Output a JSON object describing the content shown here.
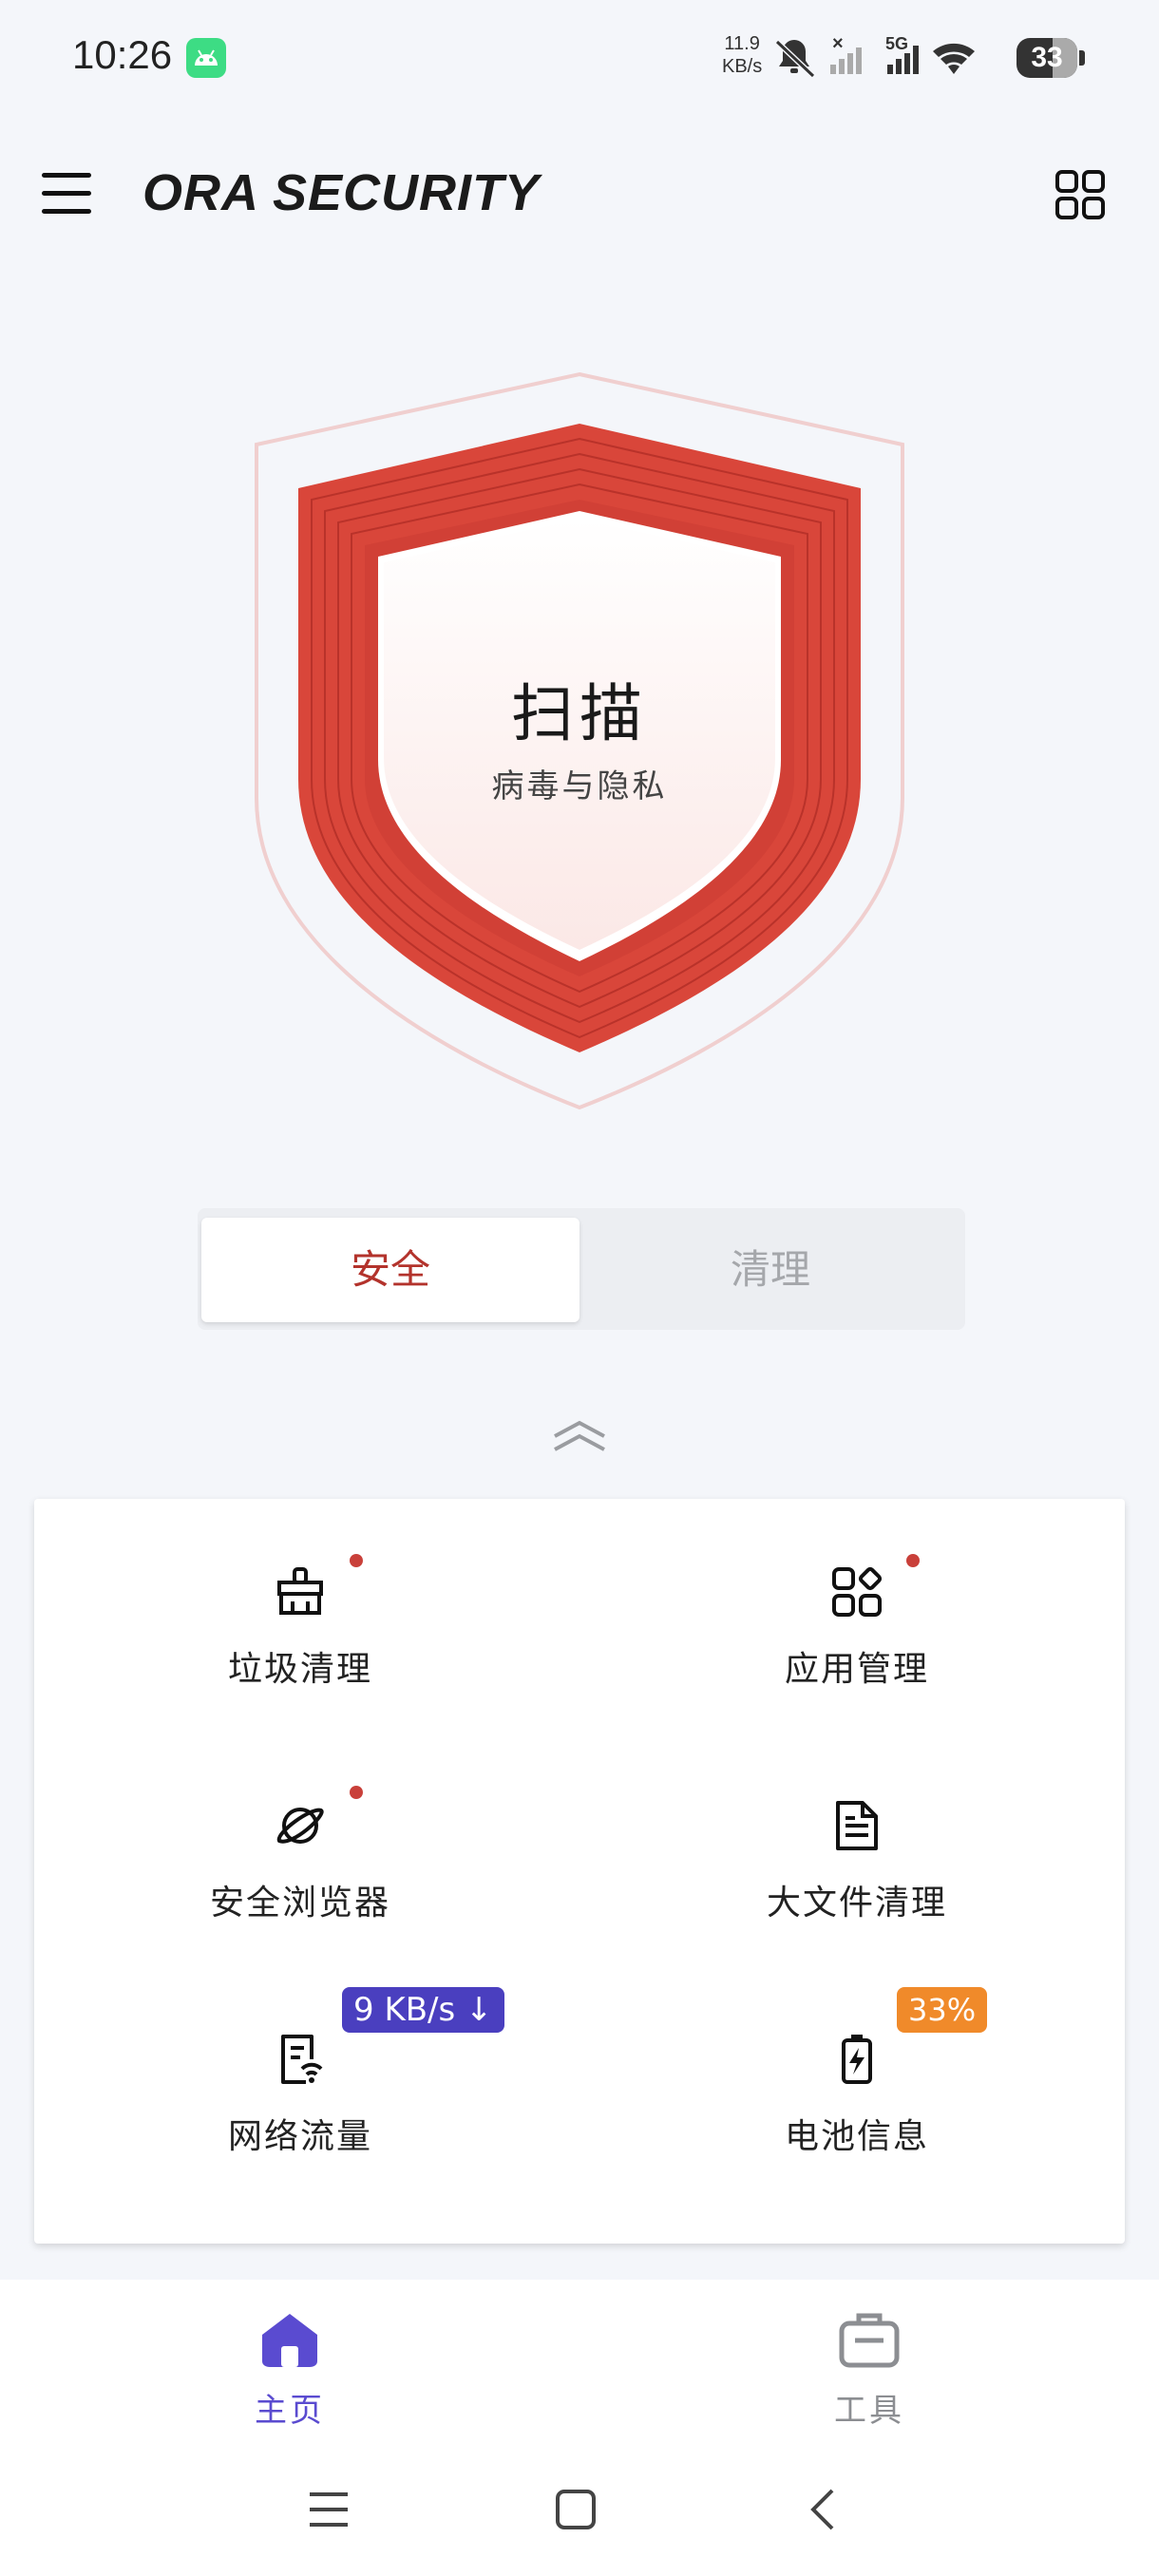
{
  "status_bar": {
    "time": "10:26",
    "speed_value": "11.9",
    "speed_unit": "KB/s",
    "network": "5G",
    "battery": "33"
  },
  "header": {
    "title": "ORA SECURITY"
  },
  "scan": {
    "title": "扫描",
    "subtitle": "病毒与隐私"
  },
  "tabs": [
    {
      "label": "安全",
      "active": true
    },
    {
      "label": "清理",
      "active": false
    }
  ],
  "tools": [
    {
      "label": "垃圾清理",
      "icon": "broom-icon",
      "dot": true
    },
    {
      "label": "应用管理",
      "icon": "apps-icon",
      "dot": true
    },
    {
      "label": "安全浏览器",
      "icon": "planet-icon",
      "dot": true
    },
    {
      "label": "大文件清理",
      "icon": "document-icon",
      "dot": false
    },
    {
      "label": "网络流量",
      "icon": "network-traffic-icon",
      "badge": "9 KB/s ↓"
    },
    {
      "label": "电池信息",
      "icon": "battery-icon",
      "badge": "33%"
    }
  ],
  "bottom_nav": [
    {
      "label": "主页",
      "icon": "home-icon",
      "active": true
    },
    {
      "label": "工具",
      "icon": "toolbox-icon",
      "active": false
    }
  ],
  "colors": {
    "accent_red": "#c9403a",
    "nav_active": "#5a4bd0",
    "badge_blue": "#4a3fbf",
    "badge_orange": "#f08a2a"
  }
}
